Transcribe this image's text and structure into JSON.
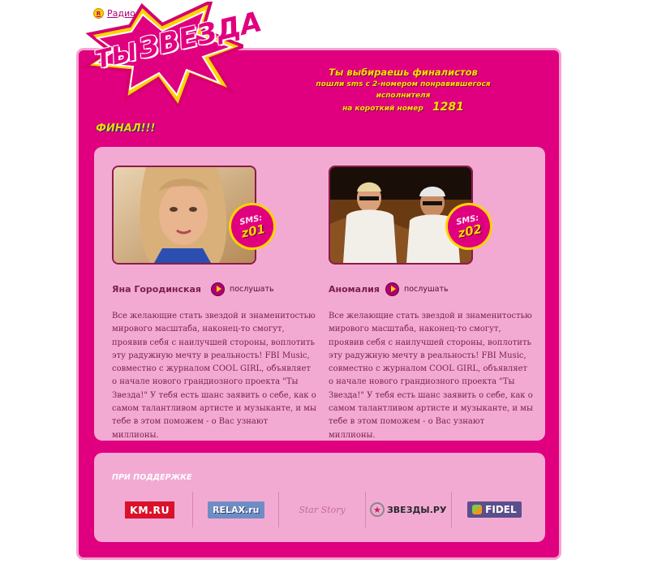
{
  "top_nav": {
    "radio_label": "Радио"
  },
  "logo": {
    "word1": "ТЫ",
    "word2": "ЗВЕЗДА"
  },
  "promo": {
    "line1": "Ты выбираешь финалистов",
    "line2": "пошли sms с 2-номером понравившегося исполнителя",
    "line3": "на короткий номер",
    "short_number": "1281"
  },
  "final_label": "ФИНАЛ!!!",
  "finalists": [
    {
      "name": "Яна Городинская",
      "sms_label": "SMS:",
      "sms_code": "z01",
      "listen_label": "послушать",
      "description": "Все желающие стать звездой и знаменитостью мирового масштаба, наконец-то смогут, проявив себя с наилучшей стороны, воплотить эту радужную мечту в реальность! FBI Music, совместно с журналом COOL GIRL, объявляет о начале нового грандиозного проекта \"Ты Звезда!\" У тебя есть шанс заявить о себе, как о самом талантливом артисте и музыканте, и мы тебе в этом поможем - о Вас узнают миллионы."
    },
    {
      "name": "Аномалия",
      "sms_label": "SMS:",
      "sms_code": "z02",
      "listen_label": "послушать",
      "description": "Все желающие стать звездой и знаменитостью мирового масштаба, наконец-то смогут, проявив себя с наилучшей стороны, воплотить эту радужную мечту в реальность! FBI Music, совместно с журналом COOL GIRL, объявляет о начале нового грандиозного проекта \"Ты Звезда!\" У тебя есть шанс заявить о себе, как о самом талантливом артисте и музыканте, и мы тебе в этом поможем - о Вас узнают миллионы."
    }
  ],
  "sponsors": {
    "title": "ПРИ ПОДДЕРЖКЕ",
    "logos": [
      "KM.RU",
      "RELAX.ru",
      "Star Story",
      "ЗВЕЗДЫ.РУ",
      "FIDEL"
    ]
  },
  "colors": {
    "page_bg": "#ffffff",
    "main_pink": "#e0007f",
    "panel_pink": "#f2aad3",
    "accent_yellow": "#ffd400",
    "text_maroon": "#7a1f4a"
  }
}
